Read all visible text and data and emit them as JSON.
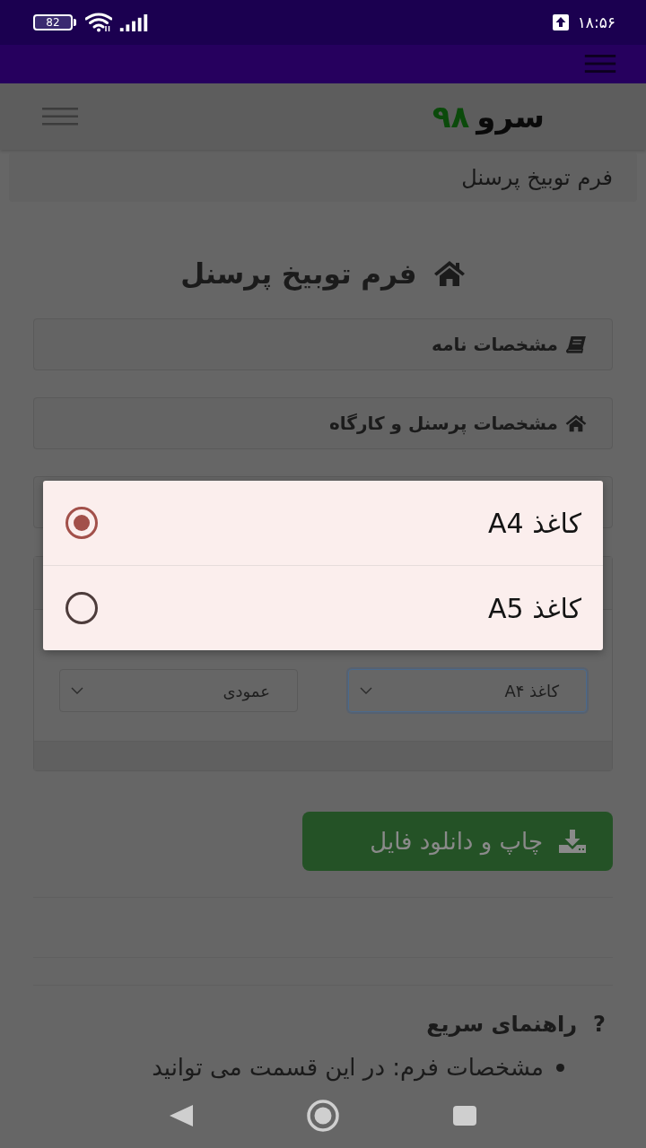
{
  "status_bar": {
    "time": "۱۸:۵۶",
    "battery": "82"
  },
  "header": {
    "logo_word": "سرو",
    "logo_number": "۹۸"
  },
  "breadcrumb": {
    "current": "فرم توبیخ پرسنل"
  },
  "page_title": "فرم توبیخ پرسنل",
  "sections": [
    {
      "title": "مشخصات نامه"
    },
    {
      "title": "مشخصات پرسنل و کارگاه"
    }
  ],
  "print_settings": {
    "selects": [
      {
        "value": "کاغذ A۴",
        "focused": true
      },
      {
        "value": "عمودی",
        "focused": false
      }
    ]
  },
  "download_button": {
    "label": "چاپ و دانلود فایل"
  },
  "help": {
    "icon": "?",
    "title": "راهنمای سریع",
    "items": [
      "مشخصات فرم: در این قسمت می توانید"
    ]
  },
  "paper_dialog": {
    "options": [
      {
        "label": "کاغذ A4",
        "selected": true
      },
      {
        "label": "کاغذ A5",
        "selected": false
      }
    ]
  }
}
